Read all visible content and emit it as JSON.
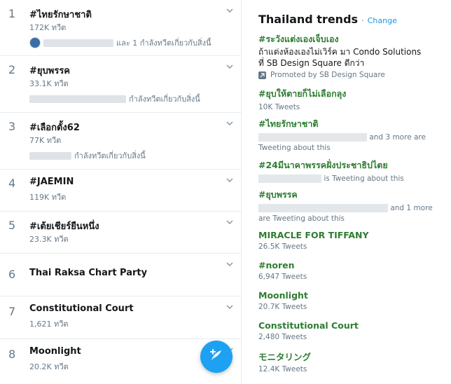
{
  "left_trends": [
    {
      "rank": "1",
      "name": "#ไทยรักษาชาติ",
      "count": "172K ทวีต",
      "context": "และ 1 กำลังทวีตเกี่ยวกับสิ่งนี้"
    },
    {
      "rank": "2",
      "name": "#ยุบพรรค",
      "count": "33.1K ทวีต",
      "context": "กำลังทวีตเกี่ยวกับสิ่งนี้"
    },
    {
      "rank": "3",
      "name": "#เลือกตั้ง62",
      "count": "77K ทวีต",
      "context": "กำลังทวีตเกี่ยวกับสิ่งนี้"
    },
    {
      "rank": "4",
      "name": "#JAEMIN",
      "count": "119K ทวีต",
      "context": ""
    },
    {
      "rank": "5",
      "name": "#เต้ยเชียร์ยืนหนึ่ง",
      "count": "23.3K ทวีต",
      "context": ""
    },
    {
      "rank": "6",
      "name": "Thai Raksa Chart Party",
      "count": "",
      "context": ""
    },
    {
      "rank": "7",
      "name": "Constitutional Court",
      "count": "1,621 ทวีต",
      "context": ""
    },
    {
      "rank": "8",
      "name": "Moonlight",
      "count": "20.2K ทวีต",
      "context": ""
    }
  ],
  "right_panel": {
    "title": "Thailand trends",
    "dot": "·",
    "change": "Change",
    "promoted": {
      "name": "#ระวังแต่งเองเจ็บเอง",
      "desc_line1": "ถ้าแต่งห้องเองไม่เวิร์ค มา Condo Solutions",
      "desc_line2": "ที่ SB Design Square ดีกว่า",
      "promoted_by": "Promoted by SB Design Square"
    },
    "trends": [
      {
        "name": "#ยุบให้ตายก็ไม่เลือกลุง",
        "sub": "10K Tweets"
      },
      {
        "name": "#ไทยรักษาชาติ",
        "sub_suffix": "and 3 more are",
        "sub2": "Tweeting about this"
      },
      {
        "name": "#24มีนาคาพรรคฝั่งประชาธิปไตย",
        "sub_suffix": "is Tweeting about this"
      },
      {
        "name": "#ยุบพรรค",
        "sub_suffix": "and 1 more",
        "sub2": "are Tweeting about this"
      },
      {
        "name": "MIRACLE FOR TIFFANY",
        "sub": "26.5K Tweets"
      },
      {
        "name": "#noren",
        "sub": "6,947 Tweets"
      },
      {
        "name": "Moonlight",
        "sub": "20.7K Tweets"
      },
      {
        "name": "Constitutional Court",
        "sub": "2,480 Tweets"
      },
      {
        "name": "モニタリング",
        "sub": "12.4K Tweets"
      }
    ]
  },
  "icons": {
    "chevron": "chevron-down-icon",
    "compose": "compose-tweet-icon",
    "promoted": "promoted-icon"
  },
  "colors": {
    "accent": "#1da1f2",
    "trend_green": "#2e7d32",
    "link": "#1b95e0"
  }
}
